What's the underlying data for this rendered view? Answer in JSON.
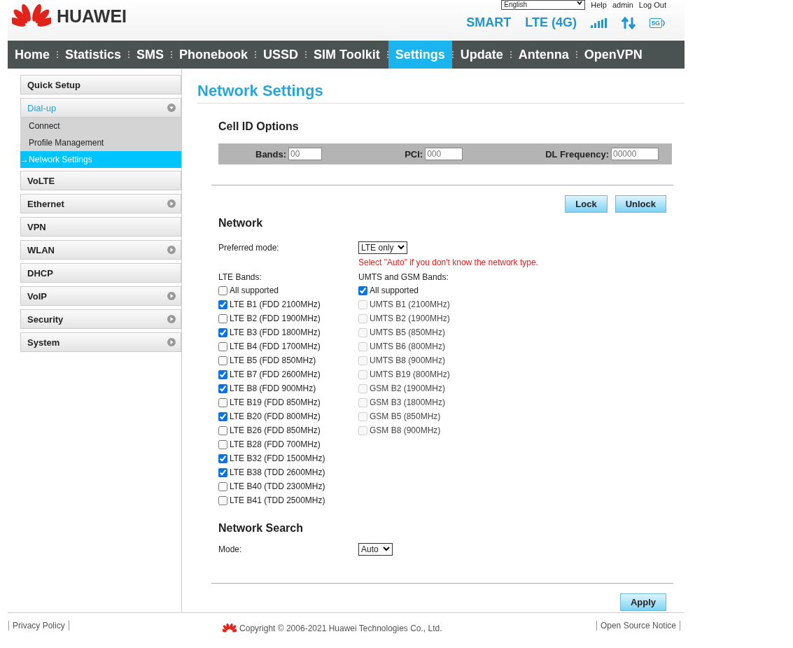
{
  "header": {
    "brand": "HUAWEI",
    "language": "English",
    "links": [
      "Help",
      "admin",
      "Log Out"
    ],
    "status": [
      "SMART",
      "LTE (4G)"
    ],
    "badge": "5G"
  },
  "nav": [
    {
      "label": "Home",
      "selected": false
    },
    {
      "label": "Statistics",
      "selected": false
    },
    {
      "label": "SMS",
      "selected": false
    },
    {
      "label": "Phonebook",
      "selected": false
    },
    {
      "label": "USSD",
      "selected": false
    },
    {
      "label": "SIM Toolkit",
      "selected": false
    },
    {
      "label": "Settings",
      "selected": true
    },
    {
      "label": "Update",
      "selected": false
    },
    {
      "label": "Antenna",
      "selected": false
    },
    {
      "label": "OpenVPN",
      "selected": false
    }
  ],
  "sidebar": {
    "items": [
      {
        "label": "Quick Setup",
        "kind": "link",
        "expanded": false,
        "selected": false
      },
      {
        "label": "Dial-up",
        "kind": "menu",
        "expanded": true,
        "selected": true,
        "children": [
          {
            "label": "Connect",
            "selected": false
          },
          {
            "label": "Profile Management",
            "selected": false
          },
          {
            "label": "Network Settings",
            "selected": true,
            "marker": "→"
          }
        ]
      },
      {
        "label": "VoLTE",
        "kind": "link",
        "expanded": false,
        "selected": false
      },
      {
        "label": "Ethernet",
        "kind": "menu",
        "expanded": false,
        "selected": false
      },
      {
        "label": "VPN",
        "kind": "link",
        "expanded": false,
        "selected": false
      },
      {
        "label": "WLAN",
        "kind": "menu",
        "expanded": false,
        "selected": false
      },
      {
        "label": "DHCP",
        "kind": "link",
        "expanded": false,
        "selected": false
      },
      {
        "label": "VoIP",
        "kind": "menu",
        "expanded": false,
        "selected": false
      },
      {
        "label": "Security",
        "kind": "menu",
        "expanded": false,
        "selected": false
      },
      {
        "label": "System",
        "kind": "menu",
        "expanded": false,
        "selected": false
      }
    ]
  },
  "page_title": "Network Settings",
  "cell_id": {
    "heading": "Cell ID Options",
    "fields": [
      {
        "label": "Bands:",
        "placeholder": "00"
      },
      {
        "label": "PCI:",
        "placeholder": "000"
      },
      {
        "label": "DL Frequency:",
        "placeholder": "00000"
      }
    ],
    "buttons": [
      "Lock",
      "Unlock"
    ]
  },
  "network": {
    "heading": "Network",
    "preferred_label": "Preferred mode:",
    "preferred_value": "LTE only",
    "note": "Select \"Auto\" if you don't know the network type.",
    "columns": [
      {
        "title": "LTE Bands:",
        "options": [
          {
            "label": "All supported",
            "checked": false,
            "disabled": false
          },
          {
            "label": "LTE B1 (FDD 2100MHz)",
            "checked": true,
            "disabled": false
          },
          {
            "label": "LTE B2 (FDD 1900MHz)",
            "checked": false,
            "disabled": false
          },
          {
            "label": "LTE B3 (FDD 1800MHz)",
            "checked": true,
            "disabled": false
          },
          {
            "label": "LTE B4 (FDD 1700MHz)",
            "checked": false,
            "disabled": false
          },
          {
            "label": "LTE B5 (FDD 850MHz)",
            "checked": false,
            "disabled": false
          },
          {
            "label": "LTE B7 (FDD 2600MHz)",
            "checked": true,
            "disabled": false
          },
          {
            "label": "LTE B8 (FDD 900MHz)",
            "checked": true,
            "disabled": false
          },
          {
            "label": "LTE B19 (FDD 850MHz)",
            "checked": false,
            "disabled": false
          },
          {
            "label": "LTE B20 (FDD 800MHz)",
            "checked": true,
            "disabled": false
          },
          {
            "label": "LTE B26 (FDD 850MHz)",
            "checked": false,
            "disabled": false
          },
          {
            "label": "LTE B28 (FDD 700MHz)",
            "checked": false,
            "disabled": false
          },
          {
            "label": "LTE B32 (FDD 1500MHz)",
            "checked": true,
            "disabled": false
          },
          {
            "label": "LTE B38 (TDD 2600MHz)",
            "checked": true,
            "disabled": false
          },
          {
            "label": "LTE B40 (TDD 2300MHz)",
            "checked": false,
            "disabled": false
          },
          {
            "label": "LTE B41 (TDD 2500MHz)",
            "checked": false,
            "disabled": false
          }
        ]
      },
      {
        "title": "UMTS and GSM Bands:",
        "options": [
          {
            "label": "All supported",
            "checked": true,
            "disabled": false
          },
          {
            "label": "UMTS B1 (2100MHz)",
            "checked": false,
            "disabled": true
          },
          {
            "label": "UMTS B2 (1900MHz)",
            "checked": false,
            "disabled": true
          },
          {
            "label": "UMTS B5 (850MHz)",
            "checked": false,
            "disabled": true
          },
          {
            "label": "UMTS B6 (800MHz)",
            "checked": false,
            "disabled": true
          },
          {
            "label": "UMTS B8 (900MHz)",
            "checked": false,
            "disabled": true
          },
          {
            "label": "UMTS B19 (800MHz)",
            "checked": false,
            "disabled": true
          },
          {
            "label": "GSM B2 (1900MHz)",
            "checked": false,
            "disabled": true
          },
          {
            "label": "GSM B3 (1800MHz)",
            "checked": false,
            "disabled": true
          },
          {
            "label": "GSM B5 (850MHz)",
            "checked": false,
            "disabled": true
          },
          {
            "label": "GSM B8 (900MHz)",
            "checked": false,
            "disabled": true
          }
        ]
      }
    ]
  },
  "network_search": {
    "heading": "Network Search",
    "mode_label": "Mode:",
    "mode_value": "Auto"
  },
  "apply": "Apply",
  "footer": {
    "left": "Privacy Policy",
    "center": "Copyright © 2006-2021 Huawei Technologies Co., Ltd.",
    "right": "Open Source Notice"
  }
}
